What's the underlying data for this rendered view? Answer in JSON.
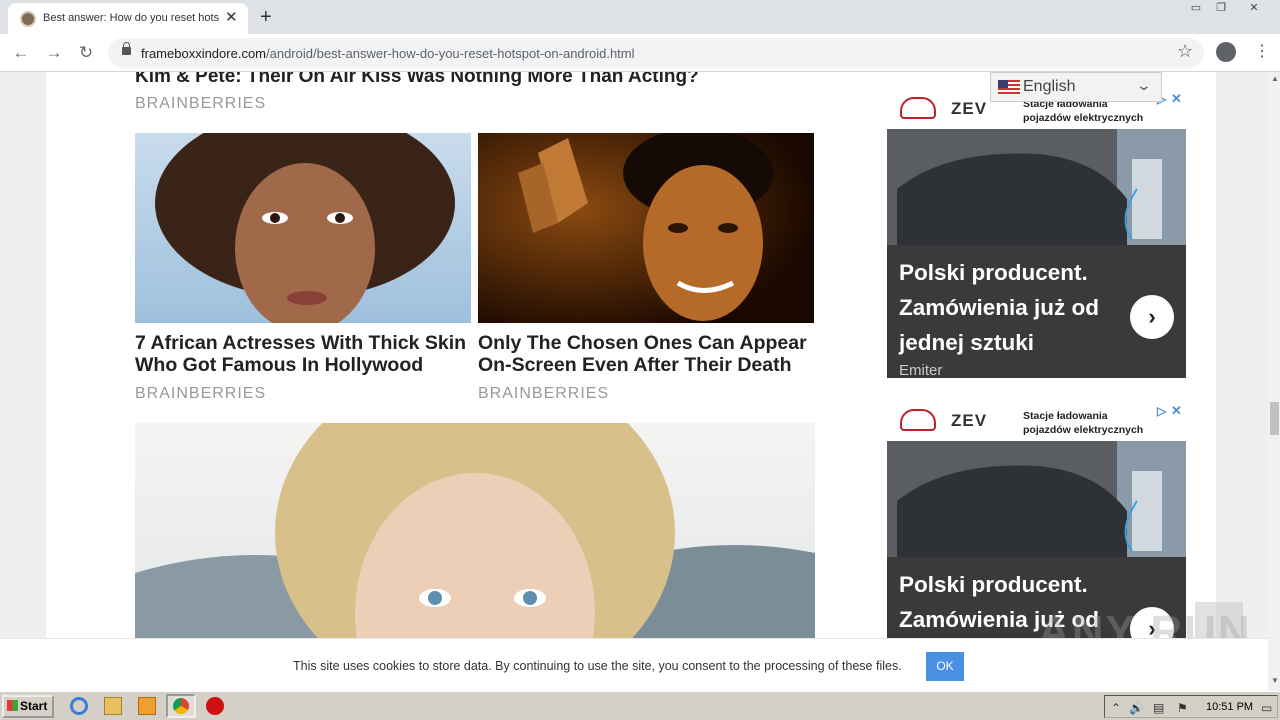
{
  "browser": {
    "tab_title": "Best answer: How do you reset hots",
    "url_host": "frameboxxindore.com",
    "url_path": "/android/best-answer-how-do-you-reset-hotspot-on-android.html"
  },
  "page": {
    "lead_title": "Kim & Pete: Their On Air Kiss Was Nothing More Than Acting?",
    "lead_source": "BRAINBERRIES",
    "cards": [
      {
        "title": "7 African Actresses With Thick Skin Who Got Famous In Hollywood",
        "source": "BRAINBERRIES"
      },
      {
        "title": "Only The Chosen Ones Can Appear On-Screen Even After Their Death",
        "source": "BRAINBERRIES"
      }
    ]
  },
  "language": {
    "selected": "English"
  },
  "ads": [
    {
      "brand_logo": "ZEV",
      "tagline_1": "Stacje ładowania",
      "tagline_2": "pojazdów elektrycznych",
      "headline": "Polski producent. Zamówienia już od jednej sztuki",
      "advertiser": "Emiter"
    },
    {
      "brand_logo": "ZEV",
      "tagline_1": "Stacje ładowania",
      "tagline_2": "pojazdów elektrycznych",
      "headline": "Polski producent. Zamówienia już od"
    }
  ],
  "cookie": {
    "text": "This site uses cookies to store data. By continuing to use the site, you consent to the processing of these files.",
    "ok_label": "OK"
  },
  "watermark": "ANY RUN",
  "taskbar": {
    "start_label": "Start",
    "clock": "10:51 PM"
  },
  "colors": {
    "accent": "#4a90e2",
    "ad_bg": "#3a3a3a",
    "source_gray": "#999999"
  }
}
